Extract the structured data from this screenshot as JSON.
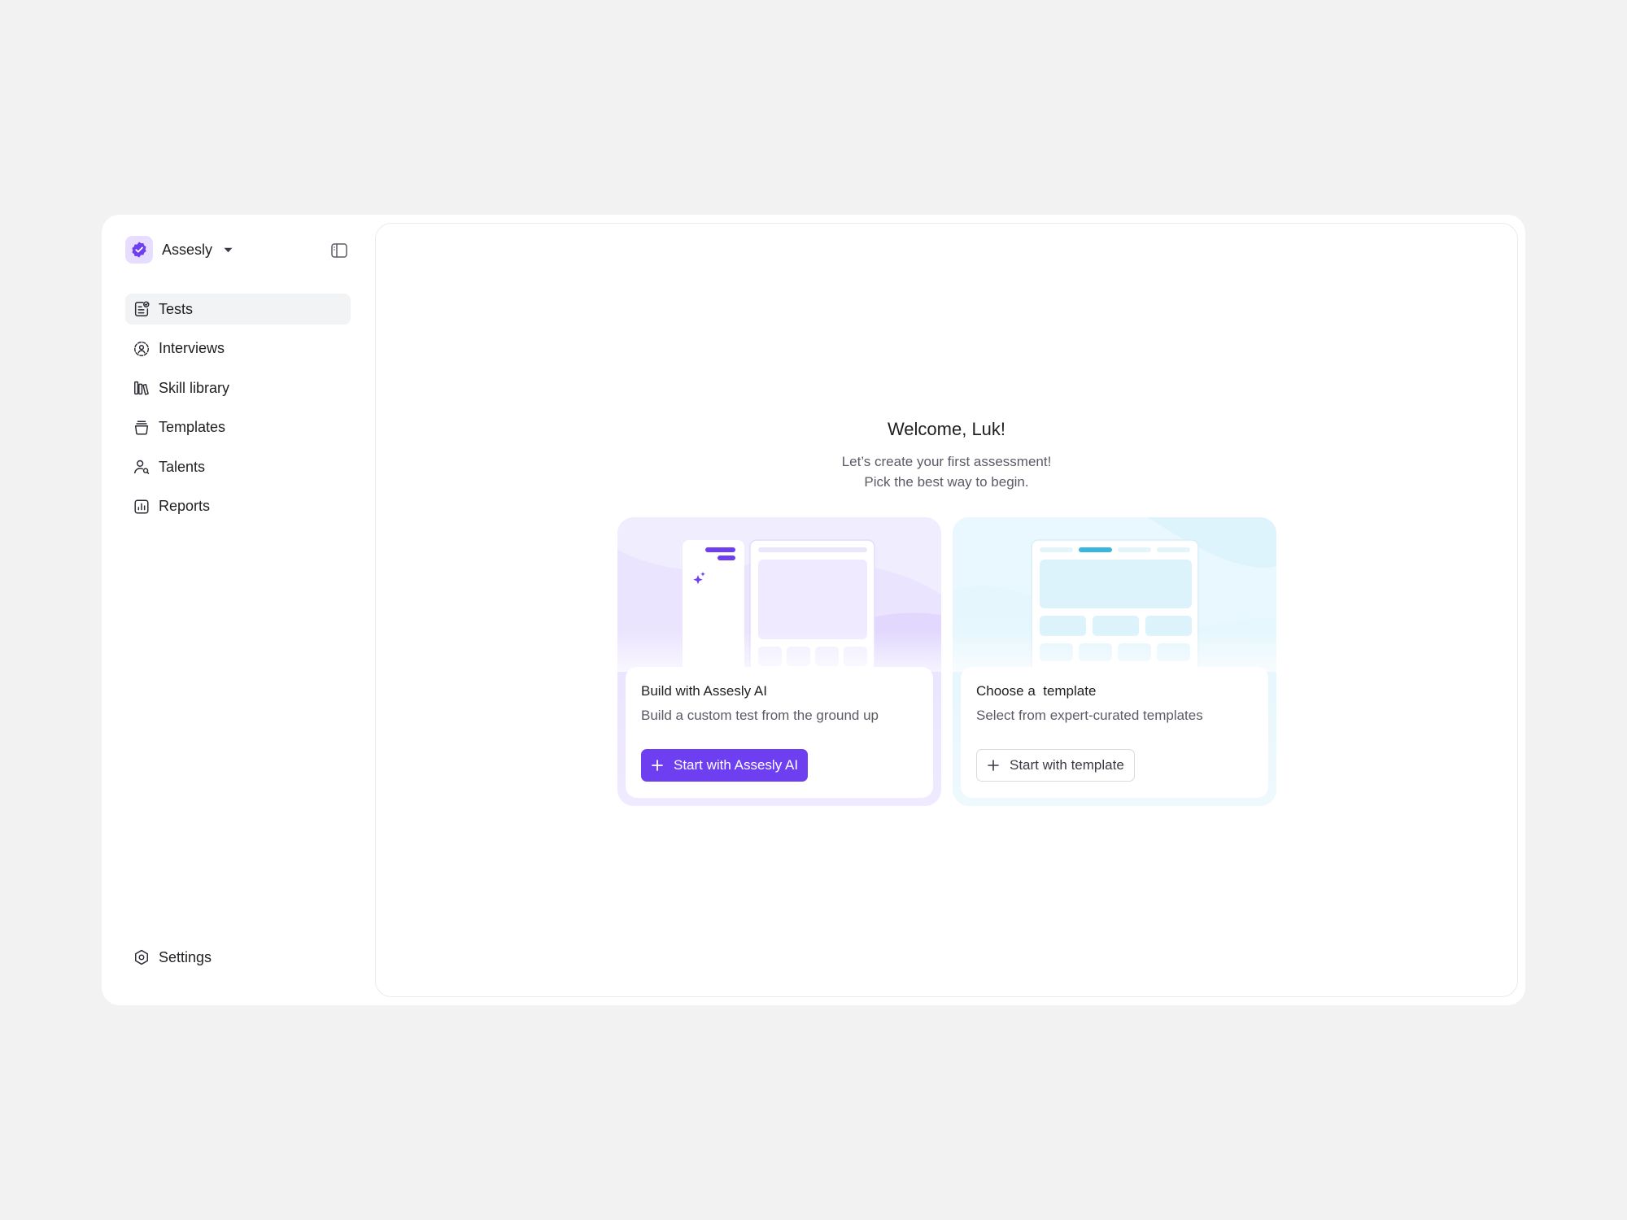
{
  "workspace": {
    "name": "Assesly",
    "logo_icon": "verified-badge-icon",
    "accent": "#6d3ff0"
  },
  "sidebar": {
    "items": [
      {
        "label": "Tests",
        "icon": "test-doc-icon",
        "active": true
      },
      {
        "label": "Interviews",
        "icon": "interview-icon",
        "active": false
      },
      {
        "label": "Skill library",
        "icon": "library-icon",
        "active": false
      },
      {
        "label": "Templates",
        "icon": "templates-icon",
        "active": false
      },
      {
        "label": "Talents",
        "icon": "talent-icon",
        "active": false
      },
      {
        "label": "Reports",
        "icon": "reports-icon",
        "active": false
      }
    ],
    "settings_label": "Settings"
  },
  "main": {
    "welcome_title": "Welcome, Luk!",
    "welcome_line1": "Let’s create your first assessment!",
    "welcome_line2": "Pick the best way to begin.",
    "cards": [
      {
        "title": "Build with Assesly AI",
        "description": "Build a custom test from the ground up",
        "button_label": "Start with Assesly AI"
      },
      {
        "title": "Choose a  template",
        "description": "Select from expert-curated templates",
        "button_label": "Start with template"
      }
    ]
  },
  "colors": {
    "accent": "#6d3ff0",
    "template_accent": "#38b6e0",
    "page_bg": "#f2f2f2"
  }
}
